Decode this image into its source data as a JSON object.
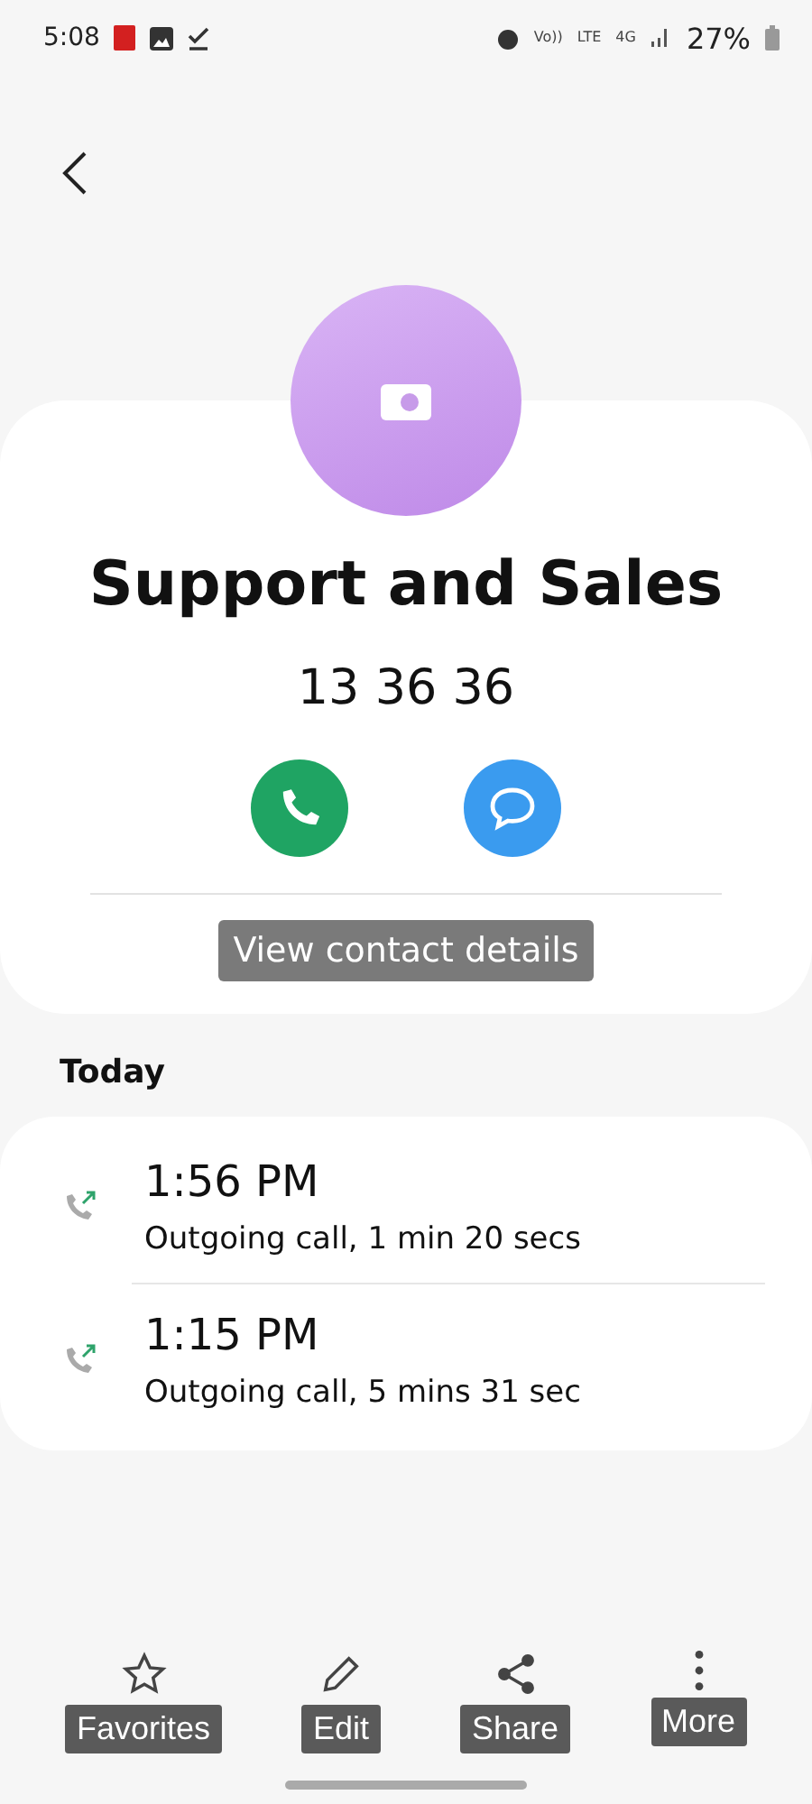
{
  "status_bar": {
    "time": "5:08",
    "network": [
      "Vo))",
      "LTE",
      "4G"
    ],
    "battery": "27%"
  },
  "contact": {
    "name": "Support and Sales",
    "number": "13 36 36",
    "details_link": "View contact details"
  },
  "history": {
    "heading": "Today",
    "calls": [
      {
        "kind": "outgoing",
        "time": "1:56 PM",
        "description": "Outgoing call, 1 min 20 secs"
      },
      {
        "kind": "outgoing",
        "time": "1:15 PM",
        "description": "Outgoing call, 5 mins 31 sec"
      }
    ]
  },
  "bottom_bar": [
    {
      "kind": "star",
      "label": "Favorites"
    },
    {
      "kind": "edit",
      "label": "Edit"
    },
    {
      "kind": "share",
      "label": "Share"
    },
    {
      "kind": "more",
      "label": "More"
    }
  ]
}
